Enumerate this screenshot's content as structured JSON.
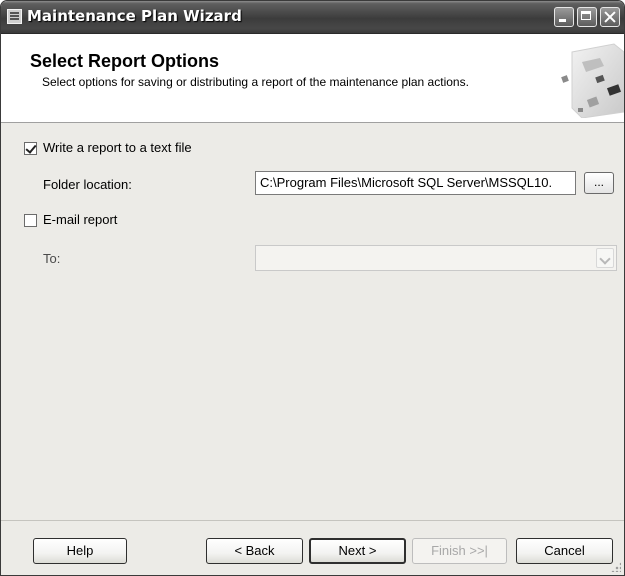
{
  "window": {
    "title": "Maintenance Plan Wizard"
  },
  "header": {
    "title": "Select Report Options",
    "subtitle": "Select options for saving or distributing a report of the maintenance plan actions."
  },
  "options": {
    "write_report": {
      "label": "Write a report to a text file",
      "checked": true
    },
    "folder": {
      "label": "Folder location:",
      "value": "C:\\Program Files\\Microsoft SQL Server\\MSSQL10.",
      "browse_label": "..."
    },
    "email_report": {
      "label": "E-mail report",
      "checked": false
    },
    "to": {
      "label": "To:",
      "value": ""
    }
  },
  "buttons": {
    "help": "Help",
    "back": "< Back",
    "next": "Next >",
    "finish": "Finish >>|",
    "cancel": "Cancel"
  }
}
